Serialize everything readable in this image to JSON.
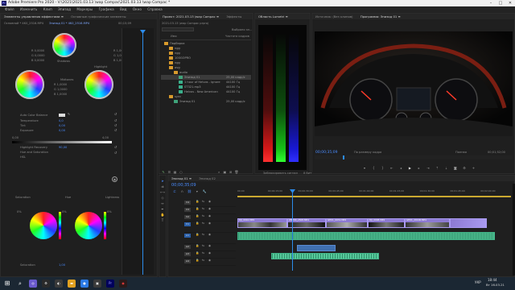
{
  "titlebar": {
    "logo": "Pr",
    "title": "Adobe Premiere Pro 2020 - V:\\2021\\2021.03.13 \\wap Compac\\2021.03.13 \\wap Compac *"
  },
  "menu": [
    "Файл",
    "Изменить",
    "Клип",
    "Эпизод",
    "Маркеры",
    "Графика",
    "Вид",
    "Окно",
    "Справка"
  ],
  "left_panel": {
    "tabs": [
      "Элементы управления эффектами",
      "Эталонный монитор",
      "Лumetri"
    ],
    "tabs_full": [
      "Элементы управления эффектами ≡",
      "Основные графические элементы"
    ],
    "source_label": "Основной * 4K0_2516.MP4",
    "clip_label": "Эпизод 01 * 4K0_2516.MP4",
    "timecode": "00;15;09",
    "wheels": [
      {
        "name": "Shadows",
        "label": "Shadows",
        "r": "0,0000",
        "g": "0,0000",
        "b": "0,0000"
      },
      {
        "name": "Midtones",
        "label": "Midtones",
        "r": "1,0000",
        "g": "1,0000",
        "b": "1,0000"
      },
      {
        "name": "Highlight",
        "label": "Highlight",
        "r": "1,0000",
        "g": "1,0000",
        "b": "1,0000"
      }
    ],
    "rows": [
      {
        "label": "Auto Color Balance",
        "value": ""
      },
      {
        "label": "Temperature",
        "value": "0,0"
      },
      {
        "label": "Tint",
        "value": "0,00"
      },
      {
        "label": "Exposure",
        "value": "0,00"
      },
      {
        "label": "Highlight Recovery",
        "value": "90,00"
      },
      {
        "label": "Hue and Saturation",
        "value": ""
      },
      {
        "label": "HSL",
        "value": ""
      }
    ],
    "range_min": "0,00",
    "range_max": "4,00",
    "small_wheels": [
      "Saturation",
      "Hue",
      "Lightness"
    ],
    "small_wheel_values": [
      "0%",
      "0%",
      "0%"
    ],
    "saturation_label": "Saturation",
    "saturation_value": "1,00"
  },
  "project": {
    "tabs": [
      "Проект: 2021.03.13 \\wap Compac ≡",
      "Эффекты"
    ],
    "path": "2021.03.13 \\wap Compac prproj",
    "found_label": "Выбрано эл...",
    "col_name": "Имя",
    "col_fps": "Частота кадров",
    "items": [
      {
        "name": "Подборка",
        "fps": "",
        "kind": "folder",
        "level": 0
      },
      {
        "name": "ngg",
        "fps": "",
        "kind": "folder",
        "level": 1
      },
      {
        "name": "ngg",
        "fps": "",
        "kind": "folder",
        "level": 1
      },
      {
        "name": "100GOPRO",
        "fps": "",
        "kind": "folder",
        "level": 1
      },
      {
        "name": "ngg",
        "fps": "",
        "kind": "folder",
        "level": 1
      },
      {
        "name": "avg",
        "fps": "",
        "kind": "folder",
        "level": 1
      },
      {
        "name": "audio",
        "fps": "",
        "kind": "folder",
        "level": 2
      },
      {
        "name": "Эпизод 01",
        "fps": "25,00 кадр/с",
        "kind": "seq",
        "level": 3
      },
      {
        "name": "1 hour of Helvos - Ignore",
        "fps": "44100 Гц",
        "kind": "audio",
        "level": 3
      },
      {
        "name": "ST321.mp3",
        "fps": "44100 Гц",
        "kind": "audio",
        "level": 3
      },
      {
        "name": "Helvos - New American",
        "fps": "44100 Гц",
        "kind": "audio",
        "level": 3
      },
      {
        "name": "sync",
        "fps": "",
        "kind": "folder",
        "level": 1
      },
      {
        "name": "Эпизод 01",
        "fps": "25,00 кадр/с",
        "kind": "seq",
        "level": 2
      }
    ]
  },
  "scopes": {
    "tab": "Область Lumetri ≡",
    "numbers": [
      "100",
      "90",
      "80",
      "70",
      "60",
      "50",
      "40",
      "30",
      "20",
      "10",
      "0"
    ],
    "footer_left": "Заблокировать сигнал",
    "footer_right": "8 бит"
  },
  "program": {
    "tabs": [
      "Источник: (без клипов)",
      "Программа: Эпизод 01 ≡"
    ],
    "timecode_left": "00;00;35;09",
    "fit_label": "По размеру кадра",
    "quality_label": "Полная",
    "timecode_right": "00;01;52;00"
  },
  "timeline": {
    "tabs": [
      "Эпизод 01 ≡",
      "Эпизод 02"
    ],
    "timecode": "00;00;35;09",
    "ruler": [
      "00;00",
      "00;00;15;00",
      "00;00;30;00",
      "00;00;45;00",
      "00;01;00;00",
      "00;01;15;00",
      "00;01;30;00",
      "00;01;45;00",
      "00;02;00;00"
    ],
    "tracks": [
      "V4",
      "V3",
      "V2",
      "V1",
      "A1",
      "A2",
      "A3",
      "A4"
    ],
    "clip_labels": [
      "DJI_0010.MP4",
      "ZMP00_2508.MP4",
      "GH01_0031.MP4",
      "DJI_0008.MP4",
      "GH01_20106.MP4"
    ]
  },
  "taskbar": {
    "lang": "УКР",
    "time": "18:44",
    "date": "Вт 16.03.21"
  }
}
